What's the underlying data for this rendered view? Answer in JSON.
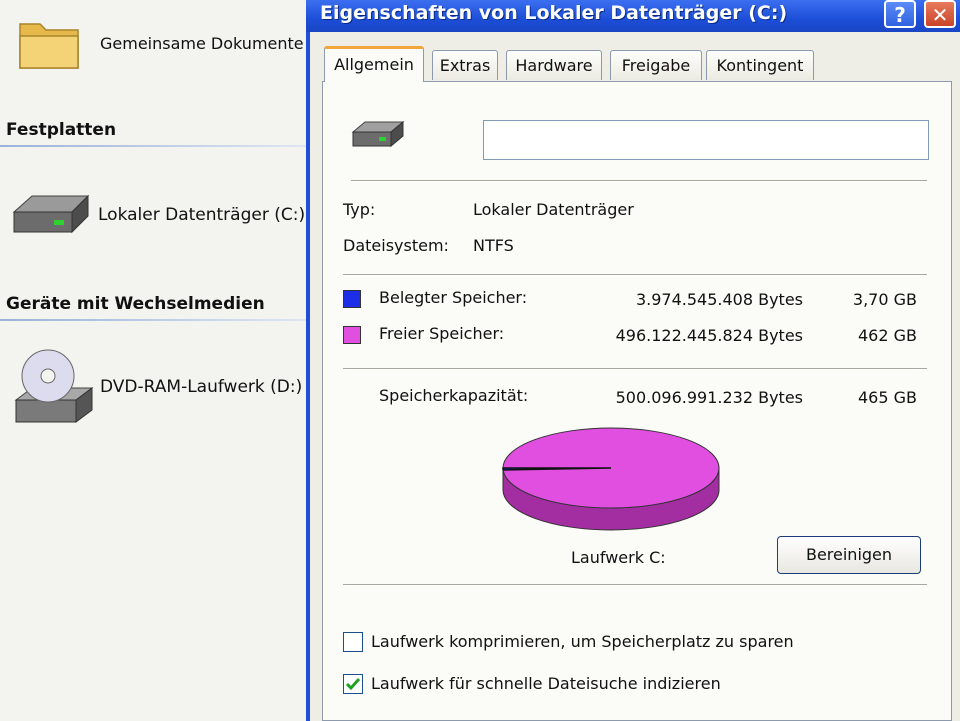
{
  "explorer": {
    "shared_docs_label": "Gemeinsame Dokumente",
    "group_hdd": "Festplatten",
    "local_disk_label": "Lokaler Datenträger (C:)",
    "group_removable": "Geräte mit Wechselmedien",
    "dvd_label": "DVD-RAM-Laufwerk (D:)"
  },
  "dialog": {
    "title": "Eigenschaften von Lokaler Datenträger (C:)",
    "help": "?",
    "close": "✕",
    "tabs": [
      "Allgemein",
      "Extras",
      "Hardware",
      "Freigabe",
      "Kontingent"
    ],
    "name_value": "",
    "type_label": "Typ:",
    "type_value": "Lokaler Datenträger",
    "fs_label": "Dateisystem:",
    "fs_value": "NTFS",
    "used_label": "Belegter Speicher:",
    "used_bytes": "3.974.545.408 Bytes",
    "used_size": "3,70 GB",
    "free_label": "Freier Speicher:",
    "free_bytes": "496.122.445.824 Bytes",
    "free_size": "462 GB",
    "capacity_label": "Speicherkapazität:",
    "capacity_bytes": "500.096.991.232 Bytes",
    "capacity_size": "465 GB",
    "drive_label": "Laufwerk C:",
    "cleanup_button": "Bereinigen",
    "compress_label": "Laufwerk komprimieren, um Speicherplatz zu sparen",
    "compress_checked": false,
    "index_label": "Laufwerk für schnelle Dateisuche indizieren",
    "index_checked": true,
    "used_fraction": 0.008,
    "colors": {
      "used": "#1c2ee6",
      "free": "#e04fe0",
      "title_bar": "#1d4ed8"
    }
  }
}
